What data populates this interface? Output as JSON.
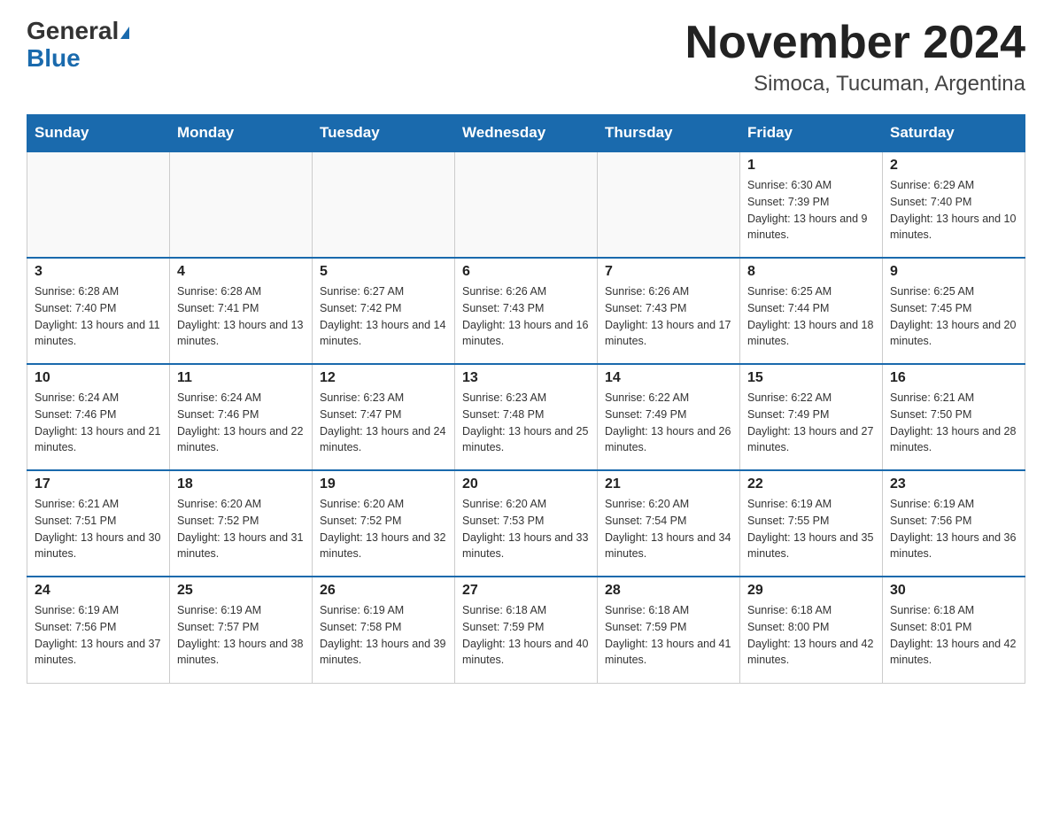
{
  "logo": {
    "general": "General",
    "blue": "Blue"
  },
  "header": {
    "title": "November 2024",
    "subtitle": "Simoca, Tucuman, Argentina"
  },
  "days_of_week": [
    "Sunday",
    "Monday",
    "Tuesday",
    "Wednesday",
    "Thursday",
    "Friday",
    "Saturday"
  ],
  "weeks": [
    [
      {
        "day": "",
        "info": ""
      },
      {
        "day": "",
        "info": ""
      },
      {
        "day": "",
        "info": ""
      },
      {
        "day": "",
        "info": ""
      },
      {
        "day": "",
        "info": ""
      },
      {
        "day": "1",
        "info": "Sunrise: 6:30 AM\nSunset: 7:39 PM\nDaylight: 13 hours and 9 minutes."
      },
      {
        "day": "2",
        "info": "Sunrise: 6:29 AM\nSunset: 7:40 PM\nDaylight: 13 hours and 10 minutes."
      }
    ],
    [
      {
        "day": "3",
        "info": "Sunrise: 6:28 AM\nSunset: 7:40 PM\nDaylight: 13 hours and 11 minutes."
      },
      {
        "day": "4",
        "info": "Sunrise: 6:28 AM\nSunset: 7:41 PM\nDaylight: 13 hours and 13 minutes."
      },
      {
        "day": "5",
        "info": "Sunrise: 6:27 AM\nSunset: 7:42 PM\nDaylight: 13 hours and 14 minutes."
      },
      {
        "day": "6",
        "info": "Sunrise: 6:26 AM\nSunset: 7:43 PM\nDaylight: 13 hours and 16 minutes."
      },
      {
        "day": "7",
        "info": "Sunrise: 6:26 AM\nSunset: 7:43 PM\nDaylight: 13 hours and 17 minutes."
      },
      {
        "day": "8",
        "info": "Sunrise: 6:25 AM\nSunset: 7:44 PM\nDaylight: 13 hours and 18 minutes."
      },
      {
        "day": "9",
        "info": "Sunrise: 6:25 AM\nSunset: 7:45 PM\nDaylight: 13 hours and 20 minutes."
      }
    ],
    [
      {
        "day": "10",
        "info": "Sunrise: 6:24 AM\nSunset: 7:46 PM\nDaylight: 13 hours and 21 minutes."
      },
      {
        "day": "11",
        "info": "Sunrise: 6:24 AM\nSunset: 7:46 PM\nDaylight: 13 hours and 22 minutes."
      },
      {
        "day": "12",
        "info": "Sunrise: 6:23 AM\nSunset: 7:47 PM\nDaylight: 13 hours and 24 minutes."
      },
      {
        "day": "13",
        "info": "Sunrise: 6:23 AM\nSunset: 7:48 PM\nDaylight: 13 hours and 25 minutes."
      },
      {
        "day": "14",
        "info": "Sunrise: 6:22 AM\nSunset: 7:49 PM\nDaylight: 13 hours and 26 minutes."
      },
      {
        "day": "15",
        "info": "Sunrise: 6:22 AM\nSunset: 7:49 PM\nDaylight: 13 hours and 27 minutes."
      },
      {
        "day": "16",
        "info": "Sunrise: 6:21 AM\nSunset: 7:50 PM\nDaylight: 13 hours and 28 minutes."
      }
    ],
    [
      {
        "day": "17",
        "info": "Sunrise: 6:21 AM\nSunset: 7:51 PM\nDaylight: 13 hours and 30 minutes."
      },
      {
        "day": "18",
        "info": "Sunrise: 6:20 AM\nSunset: 7:52 PM\nDaylight: 13 hours and 31 minutes."
      },
      {
        "day": "19",
        "info": "Sunrise: 6:20 AM\nSunset: 7:52 PM\nDaylight: 13 hours and 32 minutes."
      },
      {
        "day": "20",
        "info": "Sunrise: 6:20 AM\nSunset: 7:53 PM\nDaylight: 13 hours and 33 minutes."
      },
      {
        "day": "21",
        "info": "Sunrise: 6:20 AM\nSunset: 7:54 PM\nDaylight: 13 hours and 34 minutes."
      },
      {
        "day": "22",
        "info": "Sunrise: 6:19 AM\nSunset: 7:55 PM\nDaylight: 13 hours and 35 minutes."
      },
      {
        "day": "23",
        "info": "Sunrise: 6:19 AM\nSunset: 7:56 PM\nDaylight: 13 hours and 36 minutes."
      }
    ],
    [
      {
        "day": "24",
        "info": "Sunrise: 6:19 AM\nSunset: 7:56 PM\nDaylight: 13 hours and 37 minutes."
      },
      {
        "day": "25",
        "info": "Sunrise: 6:19 AM\nSunset: 7:57 PM\nDaylight: 13 hours and 38 minutes."
      },
      {
        "day": "26",
        "info": "Sunrise: 6:19 AM\nSunset: 7:58 PM\nDaylight: 13 hours and 39 minutes."
      },
      {
        "day": "27",
        "info": "Sunrise: 6:18 AM\nSunset: 7:59 PM\nDaylight: 13 hours and 40 minutes."
      },
      {
        "day": "28",
        "info": "Sunrise: 6:18 AM\nSunset: 7:59 PM\nDaylight: 13 hours and 41 minutes."
      },
      {
        "day": "29",
        "info": "Sunrise: 6:18 AM\nSunset: 8:00 PM\nDaylight: 13 hours and 42 minutes."
      },
      {
        "day": "30",
        "info": "Sunrise: 6:18 AM\nSunset: 8:01 PM\nDaylight: 13 hours and 42 minutes."
      }
    ]
  ]
}
